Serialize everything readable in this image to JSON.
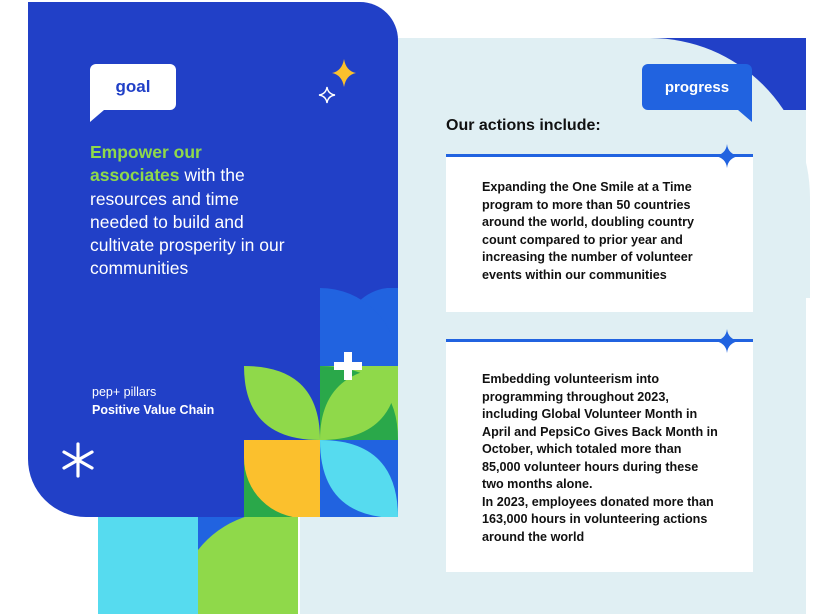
{
  "colors": {
    "primary_blue": "#2140c7",
    "accent_blue": "#2163e0",
    "green": "#8fd94a",
    "pale_bg": "#e0eff3",
    "yellow": "#fbc02d",
    "cyan": "#56dbef"
  },
  "goal": {
    "label": "goal",
    "highlight": "Empower our associates",
    "text": " with the resources and time needed to build and cultivate prosperity in our communities"
  },
  "pillars": {
    "label": "pep+ pillars",
    "value": "Positive Value Chain"
  },
  "progress": {
    "label": "progress",
    "heading": "Our actions include:",
    "actions": [
      {
        "text": "Expanding the One Smile at a Time program to more than 50 countries around the world, doubling country count compared to prior year and increasing the number of volunteer events within our communities"
      },
      {
        "text": "Embedding volunteerism into programming throughout 2023, including Global Volunteer Month in April and PepsiCo Gives Back Month in October, which totaled more than 85,000 volunteer hours during these two months alone.\nIn 2023, employees donated more than 163,000 hours in volunteering actions around the world"
      }
    ]
  },
  "icons": [
    "sparkle-icon",
    "plus-icon",
    "asterisk-icon"
  ]
}
